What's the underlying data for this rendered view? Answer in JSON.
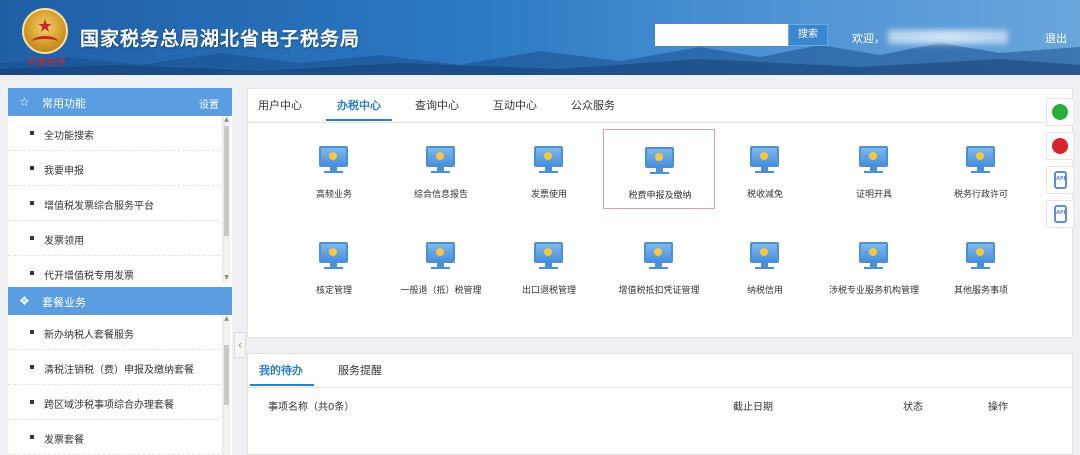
{
  "header": {
    "title": "国家税务总局湖北省电子税务局",
    "search_placeholder": "",
    "search_label": "搜索",
    "welcome": "欢迎，",
    "logout": "退出",
    "colors": {
      "bg": "#2d79c4",
      "search_btn": "#3a86cf"
    }
  },
  "sidebar": {
    "common": {
      "title": "常用功能",
      "settings": "设置",
      "icon": "star-icon",
      "items": [
        "全功能搜索",
        "我要申报",
        "增值税发票综合服务平台",
        "发票领用",
        "代开增值税专用发票"
      ]
    },
    "package": {
      "title": "套餐业务",
      "icon": "cube-icon",
      "items": [
        "新办纳税人套餐服务",
        "清税注销税（费）申报及缴纳套餐",
        "跨区域涉税事项综合办理套餐",
        "发票套餐"
      ]
    }
  },
  "main": {
    "tabs": [
      "用户中心",
      "办税中心",
      "查询中心",
      "互动中心",
      "公众服务"
    ],
    "active_tab": "办税中心",
    "services": [
      "高频业务",
      "综合信息报告",
      "发票使用",
      "税费申报及缴纳",
      "税收减免",
      "证明开具",
      "税务行政许可",
      "核定管理",
      "一般退（抵）税管理",
      "出口退税管理",
      "增值税抵扣凭证管理",
      "纳税信用",
      "涉税专业服务机构管理",
      "其他服务事项"
    ],
    "selected_service": "税费申报及缴纳",
    "accent": "#2f7fc7"
  },
  "todo": {
    "tabs": [
      "我的待办",
      "服务提醒"
    ],
    "active_tab": "我的待办",
    "columns": [
      "事项名称（共0条）",
      "截止日期",
      "状态",
      "操作"
    ]
  },
  "floating": [
    "wechat-icon",
    "weibo-icon",
    "app-icon",
    "app-icon"
  ]
}
